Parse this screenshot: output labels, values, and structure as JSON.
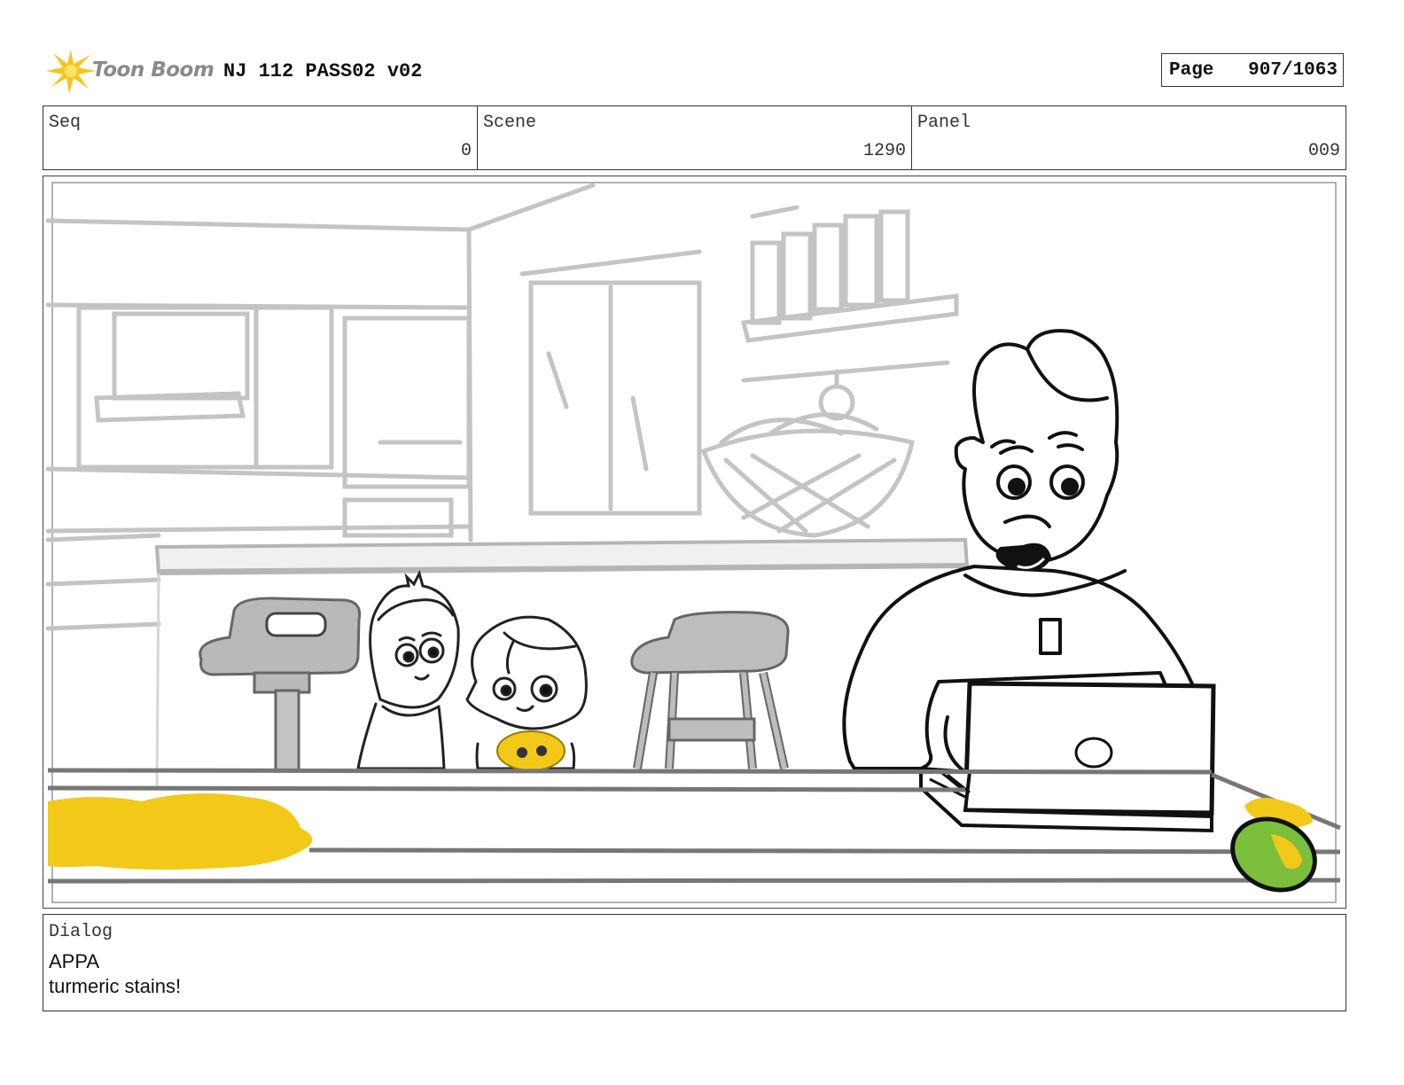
{
  "header": {
    "logo_text": "Toon Boom",
    "logo_icon": "starburst-icon",
    "project_title": "NJ 112 PASS02 v02",
    "page_label": "Page",
    "page_value": "907/1063"
  },
  "info": {
    "seq_label": "Seq",
    "seq_value": "0",
    "scene_label": "Scene",
    "scene_value": "1290",
    "panel_label": "Panel",
    "panel_value": "009"
  },
  "colors": {
    "accent_yellow": "#f2c919",
    "mango_green": "#7cbf3c",
    "sketch_gray": "#bbbbbb",
    "ink": "#111111"
  },
  "dialog": {
    "label": "Dialog",
    "speaker": "APPA",
    "line": "turmeric stains!"
  }
}
